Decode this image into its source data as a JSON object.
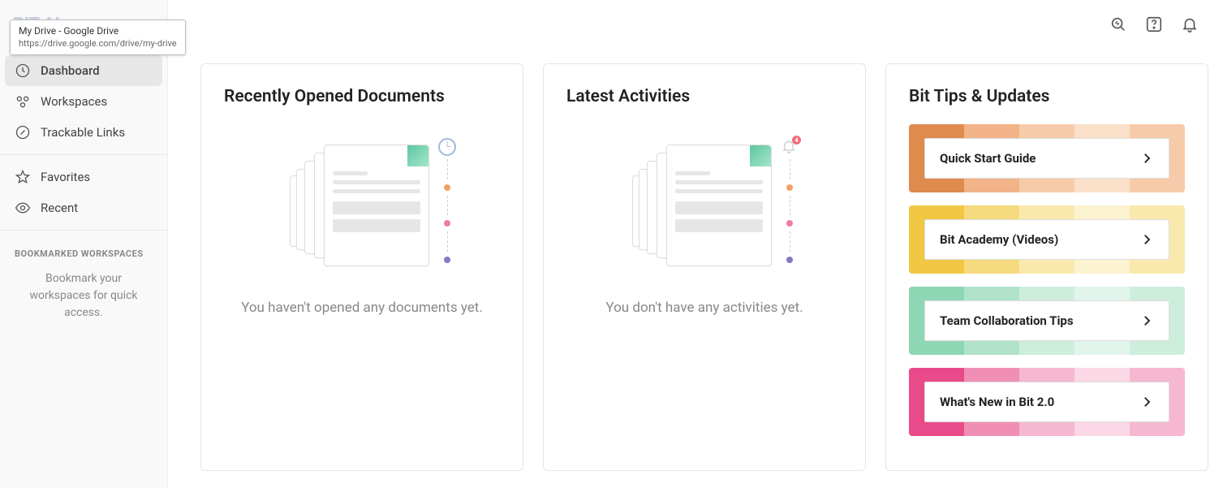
{
  "tooltip": {
    "title": "My Drive - Google Drive",
    "url": "https://drive.google.com/drive/my-drive"
  },
  "logo": "BIT AI",
  "sidebar": {
    "items": [
      {
        "label": "Dashboard"
      },
      {
        "label": "Workspaces"
      },
      {
        "label": "Trackable Links"
      },
      {
        "label": "Favorites"
      },
      {
        "label": "Recent"
      }
    ],
    "bookmarks_header": "BOOKMARKED WORKSPACES",
    "bookmarks_empty": "Bookmark your workspaces for quick access."
  },
  "recent_docs": {
    "title": "Recently Opened Documents",
    "empty": "You haven't opened any documents yet."
  },
  "activities": {
    "title": "Latest Activities",
    "empty": "You don't have any activities yet.",
    "badge": "4"
  },
  "tips": {
    "title": "Bit Tips & Updates",
    "items": [
      {
        "label": "Quick Start Guide"
      },
      {
        "label": "Bit Academy (Videos)"
      },
      {
        "label": "Team Collaboration Tips"
      },
      {
        "label": "What's New in Bit 2.0"
      }
    ]
  }
}
